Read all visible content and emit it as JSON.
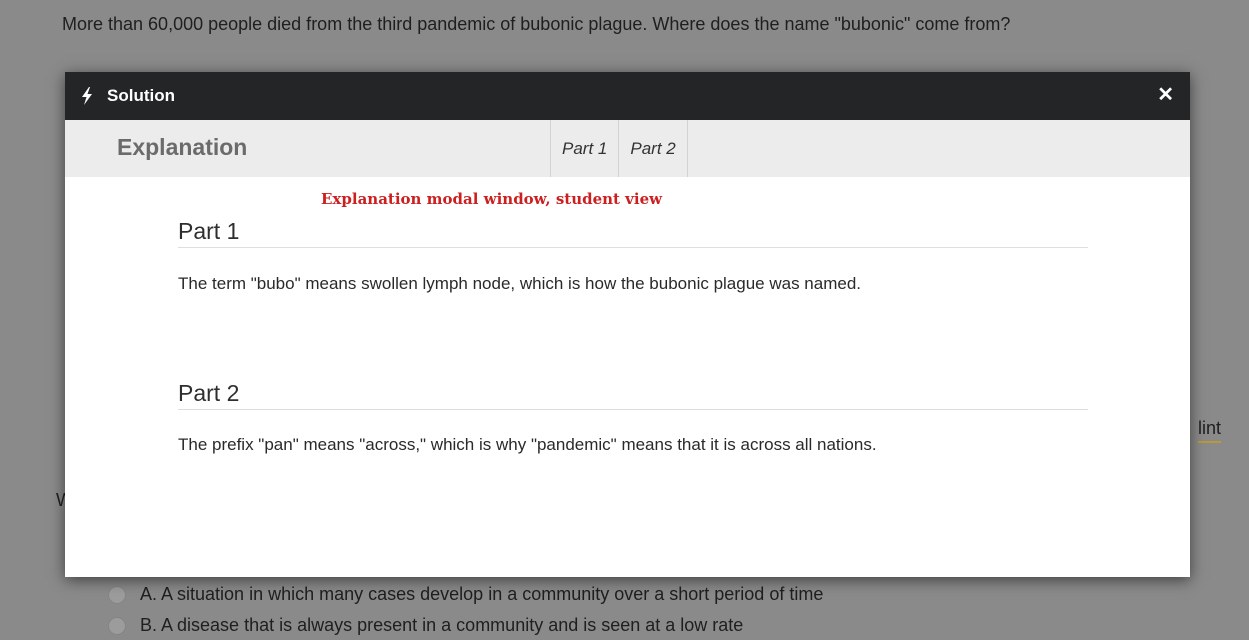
{
  "question": {
    "text": "More than 60,000 people died from the third pandemic of bubonic plague. Where does the name \"bubonic\" come from?"
  },
  "background": {
    "hint_text": "lint",
    "q2_visible_char": "W",
    "options": [
      {
        "label": "A. A situation in which many cases develop in a community over a short period of time"
      },
      {
        "label": "B. A disease that is always present in a community and is seen at a low rate"
      }
    ]
  },
  "modal": {
    "title": "Solution",
    "close_glyph": "✕",
    "section_title": "Explanation",
    "tabs": [
      {
        "label": "Part 1"
      },
      {
        "label": "Part 2"
      }
    ],
    "annotation": "Explanation modal window, student view",
    "parts": [
      {
        "heading": "Part 1",
        "text": "The term \"bubo\" means swollen lymph node, which is how the bubonic plague was named."
      },
      {
        "heading": "Part 2",
        "text": "The prefix \"pan\" means \"across,\" which is why \"pandemic\" means that it is across all nations."
      }
    ]
  },
  "icons": {
    "header": "bolt-icon",
    "close": "close-icon",
    "radio": "radio-icon"
  },
  "colors": {
    "overlay": "#8a8a8a",
    "header_bg": "#232527",
    "subheader_bg": "#ececec",
    "annotation": "#cc1f1f",
    "hint_underline": "#b89a3a"
  }
}
